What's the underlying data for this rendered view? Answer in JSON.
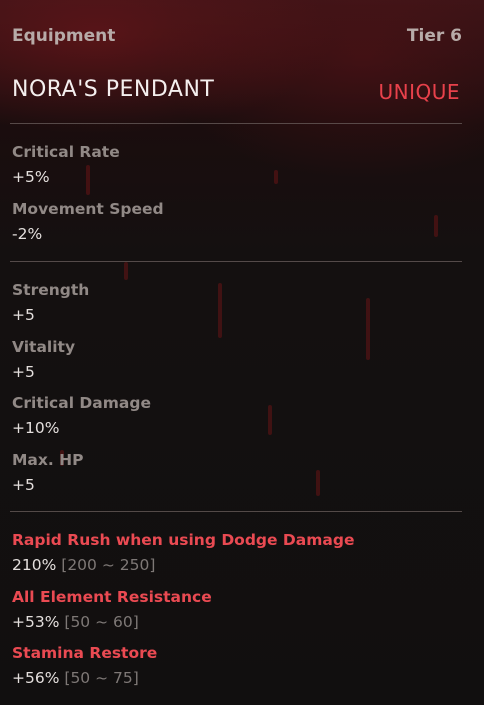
{
  "header": {
    "category": "Equipment",
    "tier": "Tier 6",
    "item_name": "NORA'S PENDANT",
    "rarity": "UNIQUE"
  },
  "colors": {
    "rarity_accent": "#e8414b",
    "special_stat": "#ea4a52",
    "stat_label": "#918986",
    "stat_value": "#e4dfdd",
    "range_text": "#7e7876"
  },
  "primary_stats": [
    {
      "name": "Critical Rate",
      "value": "+5%"
    },
    {
      "name": "Movement Speed",
      "value": "-2%"
    }
  ],
  "secondary_stats": [
    {
      "name": "Strength",
      "value": "+5"
    },
    {
      "name": "Vitality",
      "value": "+5"
    },
    {
      "name": "Critical Damage",
      "value": "+10%"
    },
    {
      "name": "Max. HP",
      "value": "+5"
    }
  ],
  "special_stats": [
    {
      "name": "Rapid Rush when using Dodge Damage",
      "value": "210%",
      "range": "[200 ~ 250]"
    },
    {
      "name": "All Element Resistance",
      "value": "+53%",
      "range": "[50 ~ 60]"
    },
    {
      "name": "Stamina Restore",
      "value": "+56%",
      "range": "[50 ~ 75]"
    }
  ]
}
